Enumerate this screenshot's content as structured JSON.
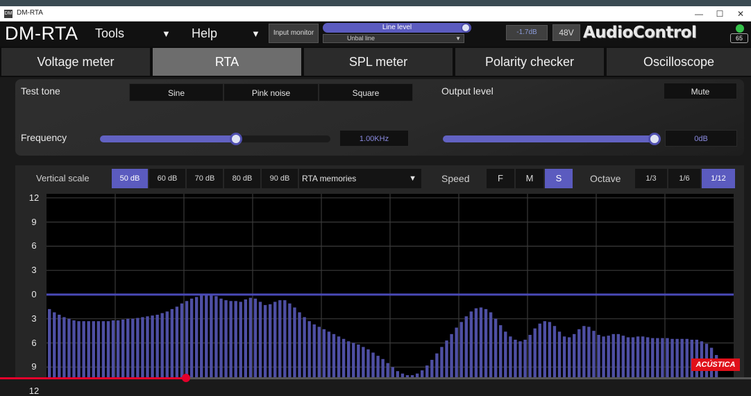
{
  "window": {
    "title": "DM-RTA",
    "app_icon_text": "DM",
    "minimize": "—",
    "maximize": "☐",
    "close": "✕"
  },
  "header": {
    "brand": "DM-RTA",
    "menus": [
      "Tools",
      "Help"
    ],
    "input_monitor": "Input monitor",
    "line_level": "Line level",
    "unbal_line": "Unbal line",
    "gain_readout": "-1.7dB",
    "phantom": "48V",
    "logo": "AudioControl",
    "battery": "65",
    "battery_color": "#35c24a"
  },
  "tabs": [
    {
      "label": "Voltage meter",
      "active": false
    },
    {
      "label": "RTA",
      "active": true
    },
    {
      "label": "SPL meter",
      "active": false
    },
    {
      "label": "Polarity checker",
      "active": false
    },
    {
      "label": "Oscilloscope",
      "active": false
    }
  ],
  "tone": {
    "test_tone_label": "Test tone",
    "waveforms": [
      "Sine",
      "Pink noise",
      "Square"
    ],
    "output_level_label": "Output level",
    "mute": "Mute",
    "frequency_label": "Frequency",
    "frequency_value": "1.00KHz",
    "frequency_slider_fraction": 0.59,
    "output_value": "0dB",
    "output_slider_fraction": 1.0
  },
  "rta": {
    "vertical_scale_label": "Vertical scale",
    "scales": [
      "50 dB",
      "60 dB",
      "70 dB",
      "80 dB",
      "90 dB"
    ],
    "selected_scale": "50 dB",
    "memories": "RTA memories",
    "speed_label": "Speed",
    "speeds": [
      "F",
      "M",
      "S"
    ],
    "selected_speed": "S",
    "octave_label": "Octave",
    "octaves": [
      "1/3",
      "1/6",
      "1/12"
    ],
    "selected_octave": "1/12",
    "accent": "#5b5bbf"
  },
  "chart_data": {
    "type": "bar",
    "y_tick_labels": [
      "12",
      "9",
      "6",
      "3",
      "0",
      "3",
      "6",
      "9",
      "12"
    ],
    "y_ticks": [
      12,
      9,
      6,
      3,
      0,
      -3,
      -6,
      -9,
      -12
    ],
    "ylim": [
      -12.5,
      12.5
    ],
    "reference_line": 0,
    "bar_color": "#4e4fa3",
    "grid": true,
    "values": [
      -1.8,
      -2.2,
      -2.5,
      -2.8,
      -3.0,
      -3.2,
      -3.3,
      -3.3,
      -3.3,
      -3.3,
      -3.3,
      -3.3,
      -3.3,
      -3.2,
      -3.2,
      -3.1,
      -3.0,
      -3.0,
      -2.9,
      -2.8,
      -2.7,
      -2.6,
      -2.5,
      -2.3,
      -2.1,
      -1.8,
      -1.5,
      -1.1,
      -0.8,
      -0.5,
      -0.3,
      -0.1,
      0.0,
      0.0,
      -0.2,
      -0.5,
      -0.7,
      -0.8,
      -0.8,
      -0.9,
      -0.6,
      -0.4,
      -0.5,
      -0.9,
      -1.3,
      -1.2,
      -0.9,
      -0.7,
      -0.7,
      -1.1,
      -1.6,
      -2.2,
      -2.8,
      -3.3,
      -3.7,
      -4.0,
      -4.3,
      -4.6,
      -4.9,
      -5.2,
      -5.5,
      -5.8,
      -6.0,
      -6.2,
      -6.5,
      -6.8,
      -7.2,
      -7.6,
      -8.0,
      -8.5,
      -9.0,
      -9.5,
      -9.8,
      -10.0,
      -10.0,
      -9.8,
      -9.4,
      -8.8,
      -8.1,
      -7.3,
      -6.5,
      -5.7,
      -4.9,
      -4.1,
      -3.4,
      -2.7,
      -2.1,
      -1.7,
      -1.6,
      -1.8,
      -2.2,
      -3.0,
      -3.8,
      -4.6,
      -5.2,
      -5.6,
      -5.8,
      -5.6,
      -5.0,
      -4.2,
      -3.6,
      -3.3,
      -3.4,
      -3.9,
      -4.6,
      -5.2,
      -5.3,
      -4.9,
      -4.3,
      -3.9,
      -4.0,
      -4.5,
      -5.0,
      -5.2,
      -5.1,
      -4.9,
      -4.9,
      -5.1,
      -5.3,
      -5.3,
      -5.2,
      -5.2,
      -5.3,
      -5.4,
      -5.4,
      -5.4,
      -5.4,
      -5.5,
      -5.5,
      -5.5,
      -5.5,
      -5.6,
      -5.6,
      -5.8,
      -6.1,
      -6.6,
      -7.5
    ]
  },
  "watermark": "ACÚSTICA"
}
